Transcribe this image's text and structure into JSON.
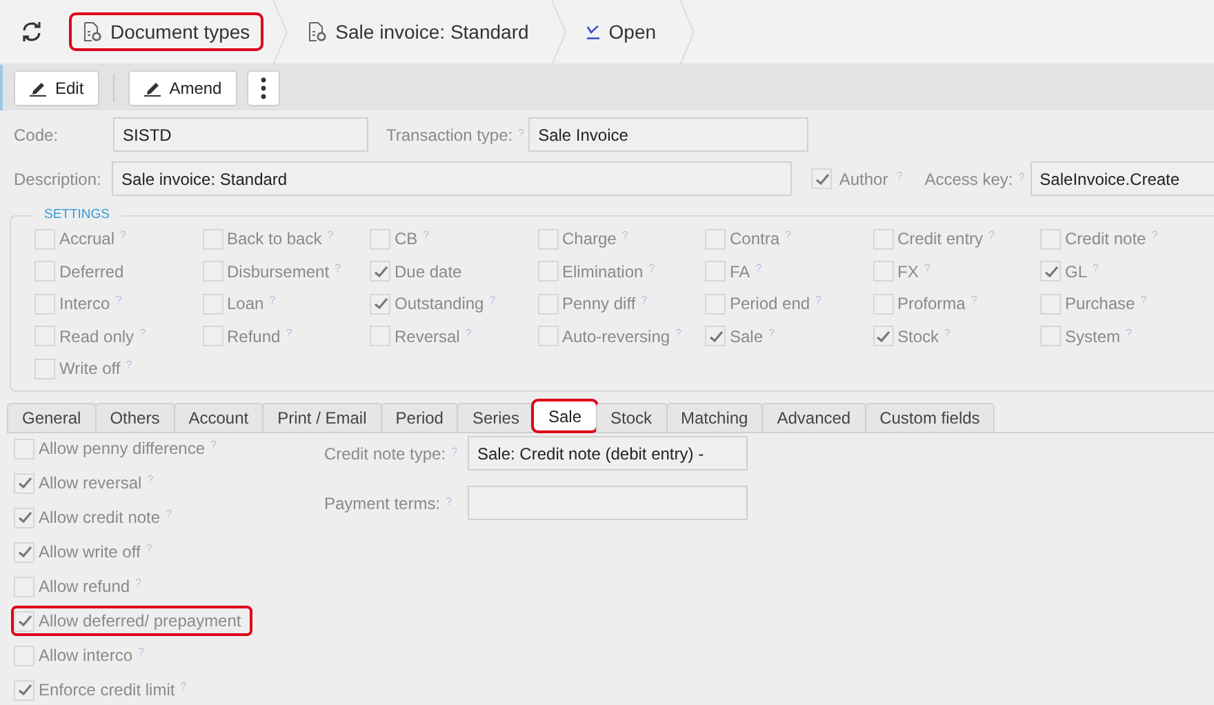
{
  "breadcrumbs": {
    "refresh": {
      "kind": "refresh"
    },
    "items": [
      {
        "label": "Document types",
        "kind": "doc-gear",
        "highlighted": true
      },
      {
        "label": "Sale invoice: Standard",
        "kind": "doc-gear",
        "highlighted": false
      },
      {
        "label": "Open",
        "kind": "check",
        "highlighted": false
      }
    ]
  },
  "toolbar": [
    {
      "kind": "pencil",
      "label": "Edit"
    },
    {
      "kind": "pencil",
      "label": "Amend"
    },
    {
      "kind": "more"
    }
  ],
  "form": {
    "code": {
      "label": "Code:",
      "value": "SISTD"
    },
    "transaction_type": {
      "label": "Transaction type:",
      "help": "?",
      "value": "Sale Invoice"
    },
    "description": {
      "label": "Description:",
      "value": "Sale invoice: Standard"
    },
    "author": {
      "label": "Author",
      "help": "?",
      "checked": true
    },
    "access_key": {
      "label": "Access key:",
      "help": "?",
      "value": "SaleInvoice.Create"
    }
  },
  "settings": {
    "title": "SETTINGS",
    "items": [
      {
        "label": "Accrual",
        "help": "?",
        "checked": false
      },
      {
        "label": "Back to back",
        "help": "?",
        "checked": false
      },
      {
        "label": "CB",
        "help": "?",
        "checked": false
      },
      {
        "label": "Charge",
        "help": "?",
        "checked": false
      },
      {
        "label": "Contra",
        "help": "?",
        "checked": false
      },
      {
        "label": "Credit entry",
        "help": "?",
        "checked": false
      },
      {
        "label": "Credit note",
        "help": "?",
        "checked": false
      },
      {
        "label": "Deferred",
        "checked": false
      },
      {
        "label": "Disbursement",
        "help": "?",
        "checked": false
      },
      {
        "label": "Due date",
        "checked": true
      },
      {
        "label": "Elimination",
        "help": "?",
        "checked": false
      },
      {
        "label": "FA",
        "help": "?",
        "checked": false
      },
      {
        "label": "FX",
        "help": "?",
        "checked": false
      },
      {
        "label": "GL",
        "help": "?",
        "checked": true
      },
      {
        "label": "Interco",
        "help": "?",
        "checked": false
      },
      {
        "label": "Loan",
        "help": "?",
        "checked": false
      },
      {
        "label": "Outstanding",
        "help": "?",
        "checked": true
      },
      {
        "label": "Penny diff",
        "help": "?",
        "checked": false
      },
      {
        "label": "Period end",
        "help": "?",
        "checked": false
      },
      {
        "label": "Proforma",
        "help": "?",
        "checked": false
      },
      {
        "label": "Purchase",
        "help": "?",
        "checked": false
      },
      {
        "label": "Read only",
        "help": "?",
        "checked": false
      },
      {
        "label": "Refund",
        "help": "?",
        "checked": false
      },
      {
        "label": "Reversal",
        "help": "?",
        "checked": false
      },
      {
        "label": "Auto-reversing",
        "help": "?",
        "checked": false
      },
      {
        "label": "Sale",
        "help": "?",
        "checked": true
      },
      {
        "label": "Stock",
        "help": "?",
        "checked": true
      },
      {
        "label": "System",
        "help": "?",
        "checked": false
      },
      {
        "label": "Write off",
        "help": "?",
        "checked": false
      }
    ]
  },
  "tabs": [
    {
      "label": "General",
      "selected": false,
      "highlighted": false
    },
    {
      "label": "Others",
      "selected": false,
      "highlighted": false
    },
    {
      "label": "Account",
      "selected": false,
      "highlighted": false
    },
    {
      "label": "Print / Email",
      "selected": false,
      "highlighted": false
    },
    {
      "label": "Period",
      "selected": false,
      "highlighted": false
    },
    {
      "label": "Series",
      "selected": false,
      "highlighted": false
    },
    {
      "label": "Sale",
      "selected": true,
      "highlighted": true
    },
    {
      "label": "Stock",
      "selected": false,
      "highlighted": false
    },
    {
      "label": "Matching",
      "selected": false,
      "highlighted": false
    },
    {
      "label": "Advanced",
      "selected": false,
      "highlighted": false
    },
    {
      "label": "Custom fields",
      "selected": false,
      "highlighted": false
    }
  ],
  "sale_tab": {
    "options": [
      {
        "label": "Allow penny difference",
        "help": "?",
        "checked": false,
        "highlighted": false
      },
      {
        "label": "Allow reversal",
        "help": "?",
        "checked": true,
        "highlighted": false
      },
      {
        "label": "Allow credit note",
        "help": "?",
        "checked": true,
        "highlighted": false
      },
      {
        "label": "Allow write off",
        "help": "?",
        "checked": true,
        "highlighted": false
      },
      {
        "label": "Allow refund",
        "help": "?",
        "checked": false,
        "highlighted": false
      },
      {
        "label": "Allow deferred/ prepayment",
        "checked": true,
        "highlighted": true
      },
      {
        "label": "Allow interco",
        "help": "?",
        "checked": false,
        "highlighted": false
      },
      {
        "label": "Enforce credit limit",
        "help": "?",
        "checked": true,
        "highlighted": false
      }
    ],
    "fields": [
      {
        "label": "Credit note type:",
        "help": "?",
        "value": "Sale: Credit note (debit entry) -"
      },
      {
        "label": "Payment terms:",
        "help": "?"
      }
    ]
  }
}
